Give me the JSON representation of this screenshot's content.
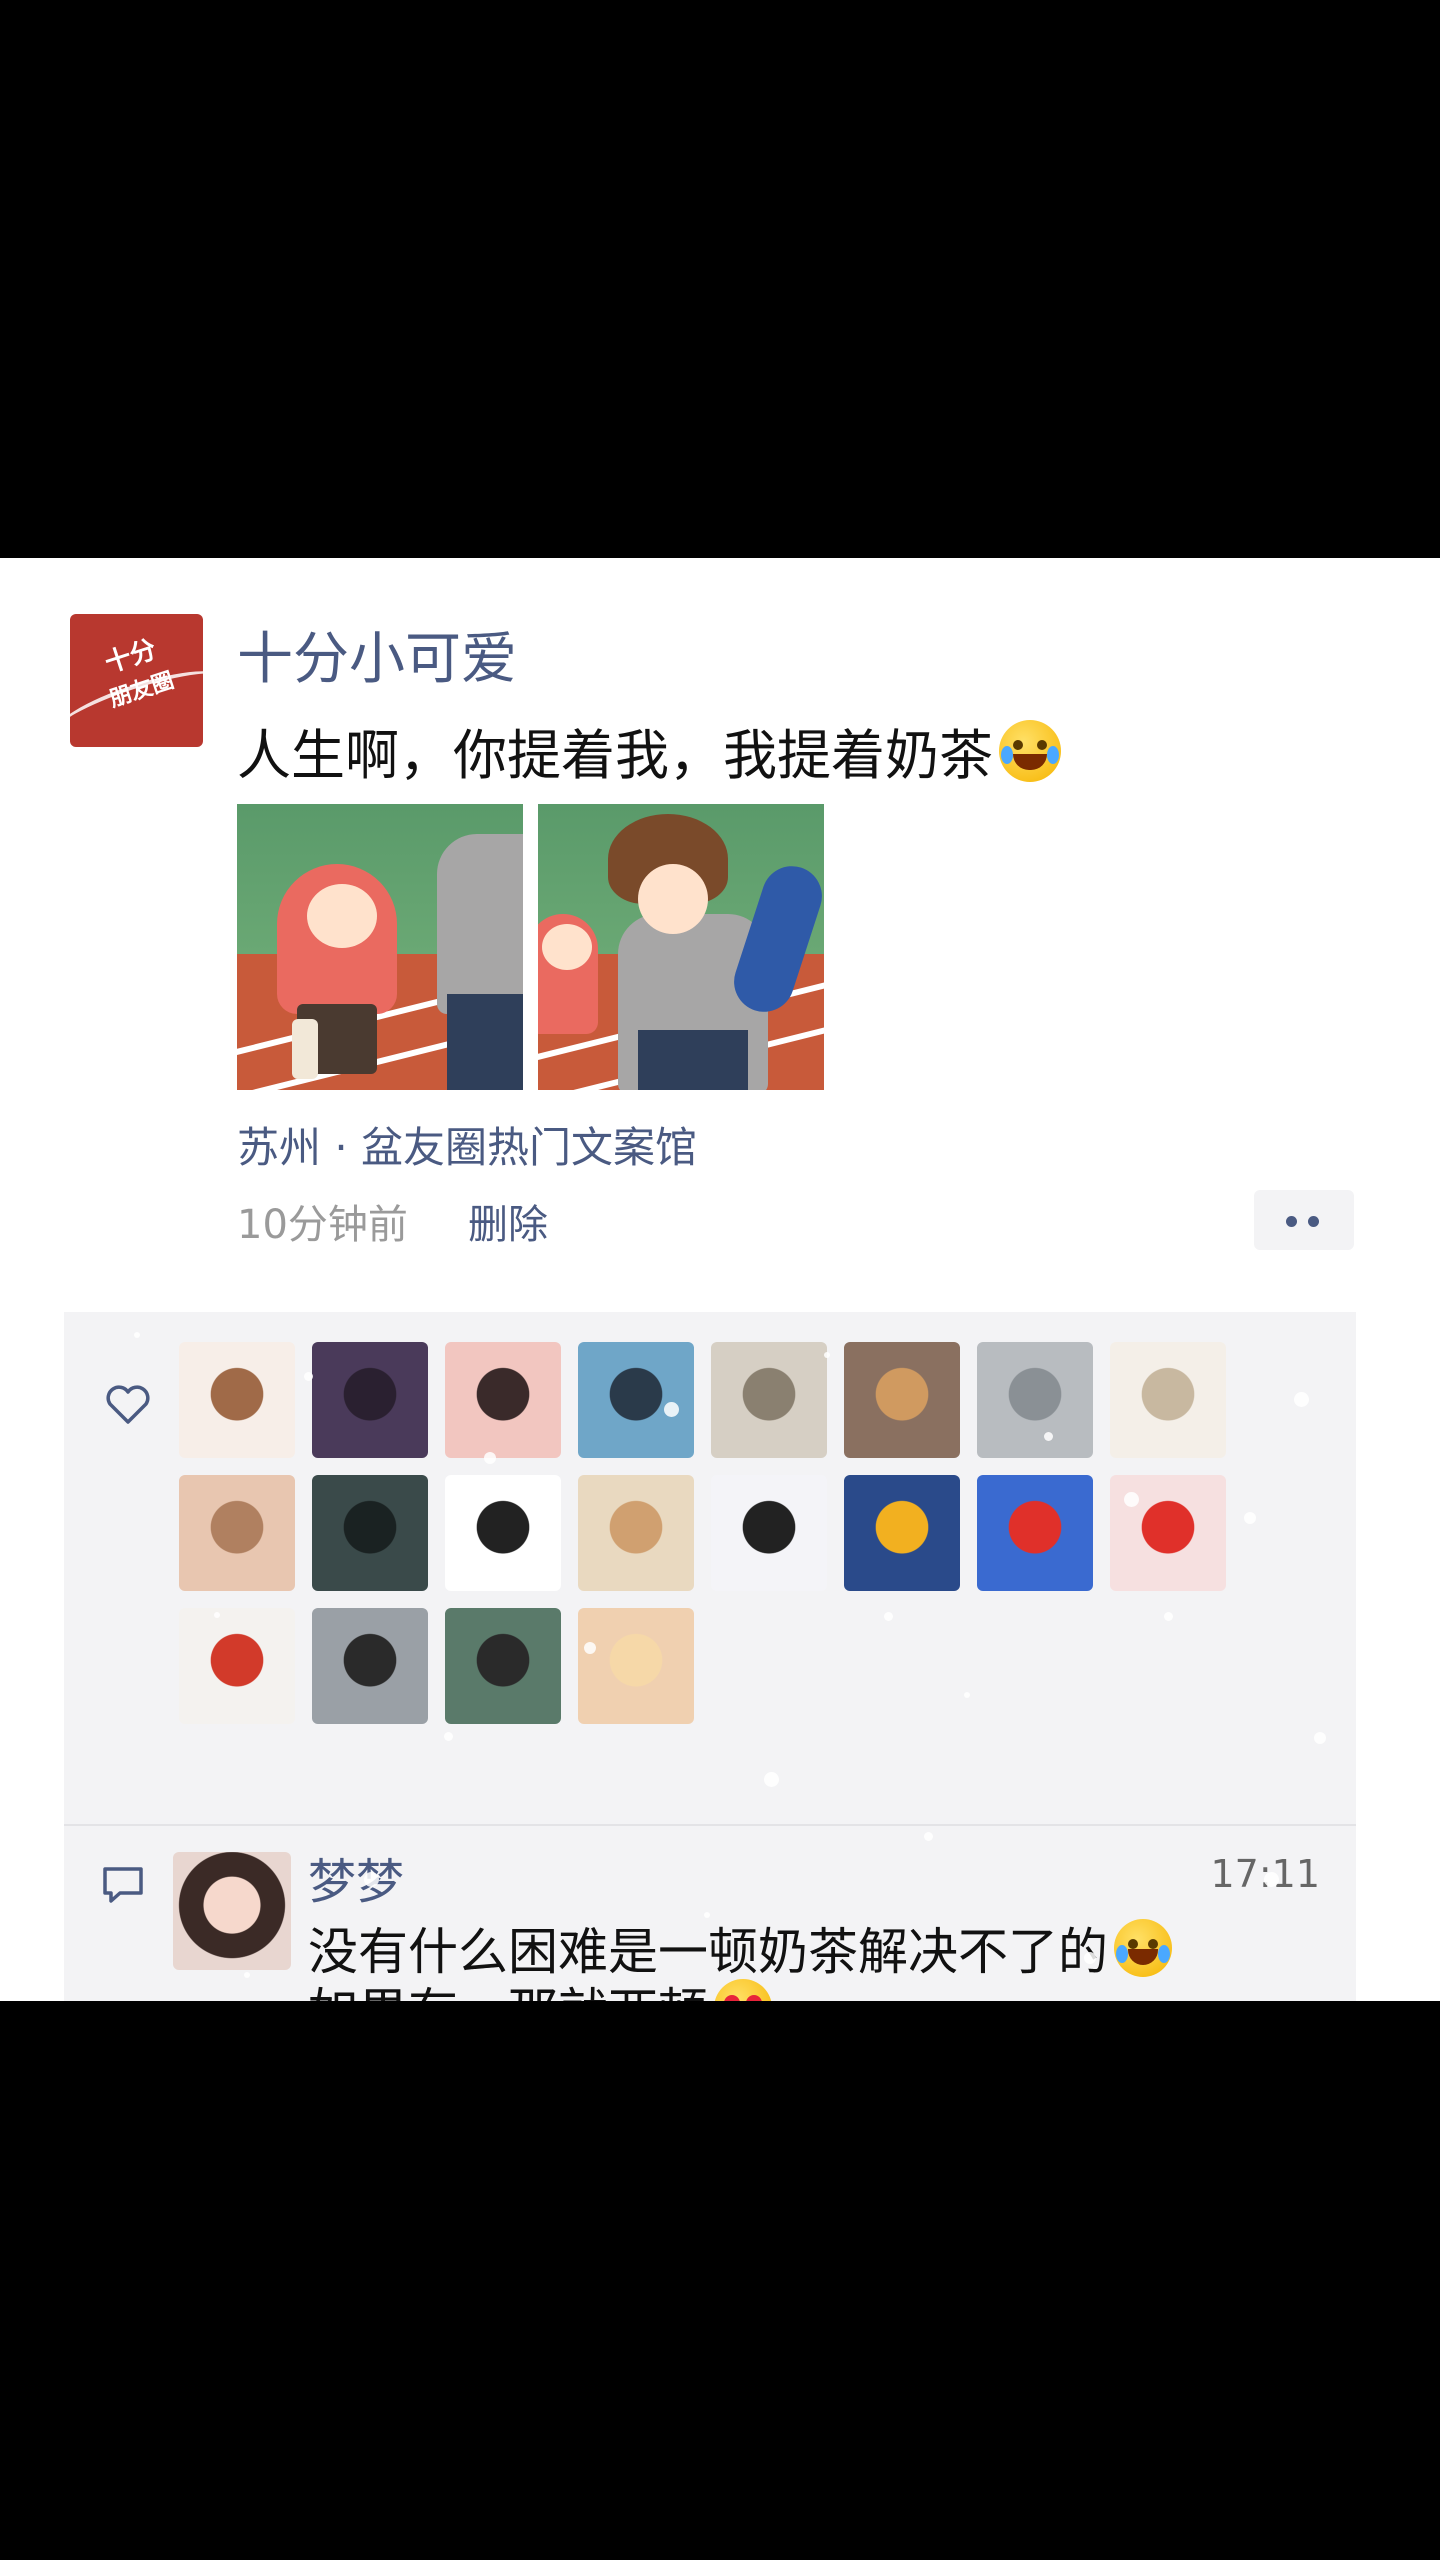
{
  "post": {
    "avatar_logo_line1": "十分",
    "avatar_logo_line2": "朋友圈",
    "poster_name": "十分小可爱",
    "text": "人生啊，你提着我，我提着奶茶",
    "text_emoji": "rolling-on-floor-laughing-emoji",
    "location": "苏州 · 盆友圈热门文案馆",
    "time": "10分钟前",
    "delete_label": "删除",
    "more_icon": "more-dots-icon",
    "photos": [
      "photo-1",
      "photo-2"
    ]
  },
  "likes": {
    "icon": "heart-outline-icon",
    "avatars": [
      {
        "name": "like-avatar-1",
        "colors": [
          "#f7eee8",
          "#a06a48"
        ]
      },
      {
        "name": "like-avatar-2",
        "colors": [
          "#4a3a5a",
          "#2a2030"
        ]
      },
      {
        "name": "like-avatar-3",
        "colors": [
          "#f2c6c0",
          "#3a2a2a"
        ]
      },
      {
        "name": "like-avatar-4",
        "colors": [
          "#6fa6c8",
          "#2a3a4a"
        ]
      },
      {
        "name": "like-avatar-5",
        "colors": [
          "#d6cfc4",
          "#8a8070"
        ]
      },
      {
        "name": "like-avatar-6",
        "colors": [
          "#8a7060",
          "#d09a60"
        ]
      },
      {
        "name": "like-avatar-7",
        "colors": [
          "#b8bcc0",
          "#8a9095"
        ]
      },
      {
        "name": "like-avatar-8",
        "colors": [
          "#f4efe8",
          "#c8b8a0"
        ]
      },
      {
        "name": "like-avatar-9",
        "colors": [
          "#e8c6b0",
          "#b08060"
        ]
      },
      {
        "name": "like-avatar-10",
        "colors": [
          "#3a4a4a",
          "#1a2222"
        ]
      },
      {
        "name": "like-avatar-11",
        "colors": [
          "#ffffff",
          "#222222"
        ]
      },
      {
        "name": "like-avatar-12",
        "colors": [
          "#e9d9c0",
          "#d0a070"
        ]
      },
      {
        "name": "like-avatar-13",
        "colors": [
          "#f4f4f8",
          "#222222"
        ]
      },
      {
        "name": "like-avatar-14",
        "colors": [
          "#2a4a8a",
          "#f2b020"
        ]
      },
      {
        "name": "like-avatar-15",
        "colors": [
          "#3a6ad0",
          "#e0302a"
        ]
      },
      {
        "name": "like-avatar-16",
        "colors": [
          "#f6e0e0",
          "#e0302a"
        ]
      },
      {
        "name": "like-avatar-17",
        "colors": [
          "#f4f2ef",
          "#d23a2a"
        ]
      },
      {
        "name": "like-avatar-18",
        "colors": [
          "#9aa0a6",
          "#2a2a2a"
        ]
      },
      {
        "name": "like-avatar-19",
        "colors": [
          "#5a7a6a",
          "#2a2a2a"
        ]
      },
      {
        "name": "like-avatar-20",
        "colors": [
          "#f0d0b0",
          "#f6d8a8"
        ]
      }
    ]
  },
  "comment": {
    "icon": "comment-bubble-icon",
    "name": "梦梦",
    "time": "17:11",
    "line1": "没有什么困难是一顿奶茶解决不了的",
    "line1_emoji": "tears-of-joy-emoji",
    "line2": "如果有，那就两顿",
    "line2_emoji": "heart-eyes-emoji"
  },
  "colors": {
    "name_blue": "#4a5a82",
    "panel_bg": "#ffffff",
    "social_bg": "#f3f3f5",
    "letterbox": "#000000"
  }
}
